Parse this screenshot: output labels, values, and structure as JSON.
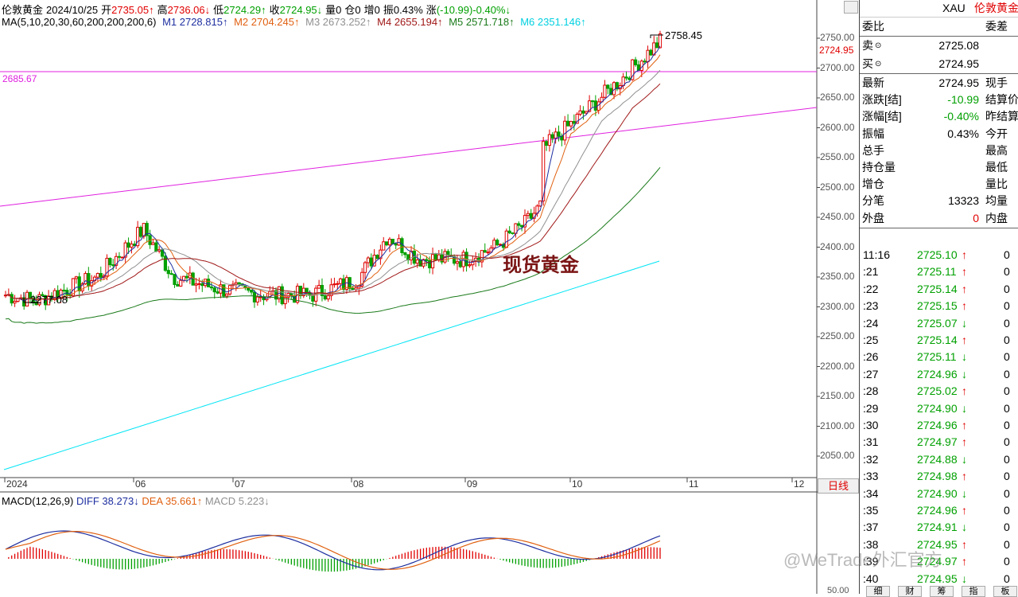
{
  "header": {
    "instrument": "伦敦黄金",
    "date": "2024/10/25",
    "open_label": "开",
    "open": "2735.05↑",
    "high_label": "高",
    "high": "2736.06↓",
    "low_label": "低",
    "low": "2724.29↑",
    "close_label": "收",
    "close": "2724.95↓",
    "vol_label": "量",
    "vol": "0",
    "oi_label": "仓",
    "oi": "0",
    "inc_label": "增",
    "inc": "0",
    "amp_label": "振",
    "amp": "0.43%",
    "chg_label": "涨",
    "chg": "(-10.99)-0.40%↓"
  },
  "ma": {
    "label": "MA(5,10,20,30,60,200,200,200,6)",
    "m1": "M1 2728.815↑",
    "m2": "M2 2704.245↑",
    "m3": "M3 2673.252↑",
    "m4": "M4 2655.194↑",
    "m5": "M5 2571.718↑",
    "m6": "M6 2351.146↑"
  },
  "colors": {
    "m1": "#1e2fa0",
    "m2": "#e06010",
    "m3": "#909090",
    "m4": "#a01818",
    "m5": "#1a7a1a",
    "m6": "#00e5f5",
    "trend": "#e020e0",
    "up": "#e00000",
    "down": "#00a000"
  },
  "annotations": {
    "high_mark": "2758.45",
    "low_mark": "2277.08",
    "hline_label": "2685.67",
    "watermark": "现货黄金",
    "last_price": "2724.95"
  },
  "yaxis": [
    "2750.00",
    "2700.00",
    "2650.00",
    "2600.00",
    "2550.00",
    "2500.00",
    "2450.00",
    "2400.00",
    "2350.00",
    "2300.00",
    "2250.00",
    "2200.00",
    "2150.00",
    "2100.00",
    "2050.00"
  ],
  "xaxis": [
    "2024",
    "06",
    "07",
    "08",
    "09",
    "10",
    "11",
    "12"
  ],
  "period_button": "日线",
  "macd": {
    "label": "MACD(12,26,9)",
    "diff": "DIFF 38.273↓",
    "dea": "DEA 35.661↑",
    "macd": "MACD 5.223↓"
  },
  "macd_axis_bottom": "50.00",
  "panel": {
    "symbol": "XAU",
    "name": "伦敦黄金",
    "weibi_label": "委比",
    "weicha_label": "委差",
    "sell_label": "卖",
    "sell": "2725.08",
    "buy_label": "买",
    "buy": "2724.95",
    "stats": [
      {
        "label": "最新",
        "value": "2724.95",
        "value_color": "#000",
        "right": "现手"
      },
      {
        "label": "涨跌[结]",
        "value": "-10.99",
        "value_color": "#00a000",
        "right": "结算价"
      },
      {
        "label": "涨幅[结]",
        "value": "-0.40%",
        "value_color": "#00a000",
        "right": "昨结算"
      },
      {
        "label": "振幅",
        "value": "0.43%",
        "value_color": "#000",
        "right": "今开"
      },
      {
        "label": "总手",
        "value": "",
        "value_color": "#000",
        "right": "最高"
      },
      {
        "label": "持仓量",
        "value": "",
        "value_color": "#000",
        "right": "最低"
      },
      {
        "label": "增仓",
        "value": "",
        "value_color": "#000",
        "right": "量比"
      },
      {
        "label": "分笔",
        "value": "13323",
        "value_color": "#000",
        "right": "均量"
      },
      {
        "label": "外盘",
        "value": "0",
        "value_color": "#e00000",
        "right": "内盘"
      }
    ],
    "ticks": [
      {
        "t": "11:16",
        "p": "2725.10",
        "d": "↑",
        "v": "0"
      },
      {
        "t": ":21",
        "p": "2725.11",
        "d": "↑",
        "v": "0"
      },
      {
        "t": ":22",
        "p": "2725.14",
        "d": "↑",
        "v": "0"
      },
      {
        "t": ":23",
        "p": "2725.15",
        "d": "↑",
        "v": "0"
      },
      {
        "t": ":24",
        "p": "2725.07",
        "d": "↓",
        "v": "0"
      },
      {
        "t": ":25",
        "p": "2725.14",
        "d": "↑",
        "v": "0"
      },
      {
        "t": ":26",
        "p": "2725.11",
        "d": "↓",
        "v": "0"
      },
      {
        "t": ":27",
        "p": "2724.96",
        "d": "↓",
        "v": "0"
      },
      {
        "t": ":28",
        "p": "2725.02",
        "d": "↑",
        "v": "0"
      },
      {
        "t": ":29",
        "p": "2724.90",
        "d": "↓",
        "v": "0"
      },
      {
        "t": ":30",
        "p": "2724.96",
        "d": "↑",
        "v": "0"
      },
      {
        "t": ":31",
        "p": "2724.97",
        "d": "↑",
        "v": "0"
      },
      {
        "t": ":32",
        "p": "2724.88",
        "d": "↓",
        "v": "0"
      },
      {
        "t": ":33",
        "p": "2724.98",
        "d": "↑",
        "v": "0"
      },
      {
        "t": ":34",
        "p": "2724.90",
        "d": "↓",
        "v": "0"
      },
      {
        "t": ":35",
        "p": "2724.96",
        "d": "↑",
        "v": "0"
      },
      {
        "t": ":37",
        "p": "2724.91",
        "d": "↓",
        "v": "0"
      },
      {
        "t": ":38",
        "p": "2724.95",
        "d": "↑",
        "v": "0"
      },
      {
        "t": ":39",
        "p": "2724.97",
        "d": "↑",
        "v": "0"
      },
      {
        "t": ":40",
        "p": "2724.95",
        "d": "↓",
        "v": "0"
      }
    ],
    "bottom_tabs": [
      "细",
      "财",
      "筹",
      "指",
      "板"
    ]
  },
  "watermark_credit": "@WeTrade外汇官方"
}
